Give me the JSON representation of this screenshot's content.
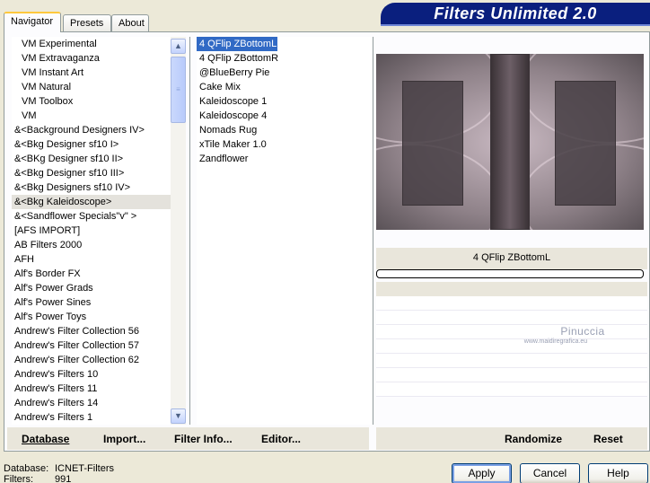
{
  "tabs": [
    {
      "label": "Navigator",
      "active": true
    },
    {
      "label": "Presets",
      "active": false
    },
    {
      "label": "About",
      "active": false
    }
  ],
  "title": "Filters Unlimited 2.0",
  "categories": [
    "VM Experimental",
    "VM Extravaganza",
    "VM Instant Art",
    "VM Natural",
    "VM Toolbox",
    "VM",
    "&<Background Designers IV>",
    "&<Bkg Designer sf10 I>",
    "&<BKg Designer sf10 II>",
    "&<Bkg Designer sf10 III>",
    "&<Bkg Designers sf10 IV>",
    "&<Bkg Kaleidoscope>",
    "&<Sandflower Specials\"v\" >",
    "[AFS IMPORT]",
    "AB Filters 2000",
    "AFH",
    "Alf's Border FX",
    "Alf's Power Grads",
    "Alf's Power Sines",
    "Alf's Power Toys",
    "Andrew's Filter Collection 56",
    "Andrew's Filter Collection 57",
    "Andrew's Filter Collection 62",
    "Andrew's Filters 10",
    "Andrew's Filters 11",
    "Andrew's Filters 14",
    "Andrew's Filters 1"
  ],
  "selected_category": "&<Bkg Kaleidoscope>",
  "filters": [
    "4 QFlip ZBottomL",
    "4 QFlip ZBottomR",
    "@BlueBerry Pie",
    "Cake Mix",
    "Kaleidoscope 1",
    "Kaleidoscope 4",
    "Nomads Rug",
    "xTile Maker 1.0",
    "Zandflower"
  ],
  "selected_filter": "4 QFlip ZBottomL",
  "scroll_icons": {
    "up": "▲",
    "down": "▼",
    "grip": "≡"
  },
  "preview_filter_name": "4 QFlip ZBottomL",
  "progress": 0,
  "watermark": {
    "name": "Pinuccia",
    "site": "www.maidiregrafica.eu"
  },
  "commands": {
    "database": "Database",
    "import": "Import...",
    "filter_info": "Filter Info...",
    "editor": "Editor...",
    "randomize": "Randomize",
    "reset": "Reset"
  },
  "status": {
    "database_label": "Database:",
    "database_value": "ICNET-Filters",
    "filters_label": "Filters:",
    "filters_value": "991"
  },
  "buttons": {
    "apply": "Apply",
    "cancel": "Cancel",
    "help": "Help"
  }
}
